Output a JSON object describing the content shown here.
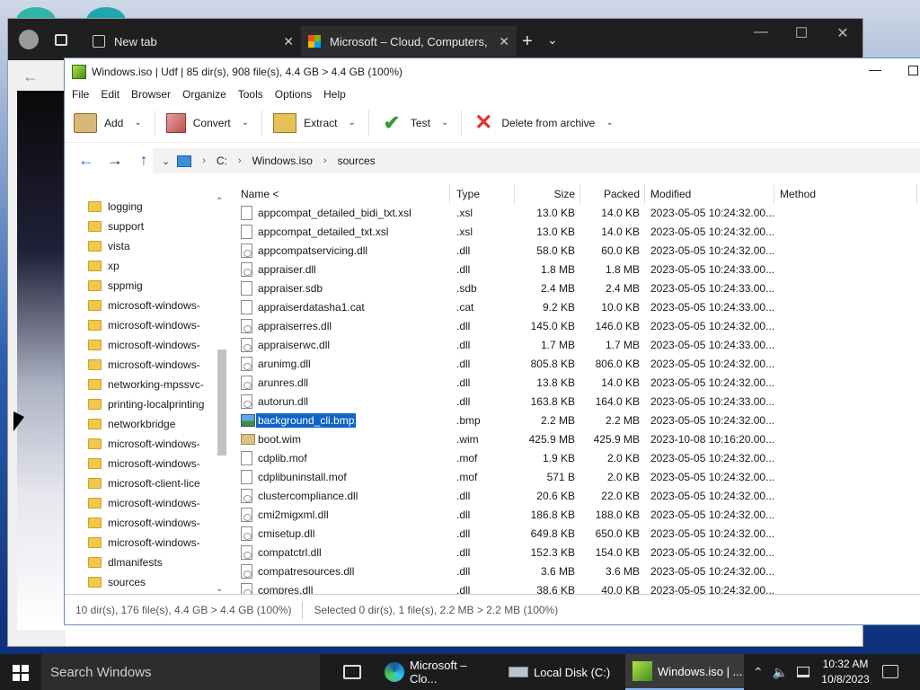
{
  "browser": {
    "tab1": "New tab",
    "tab2": "Microsoft – Cloud, Computers, A",
    "new_tab": "+",
    "tabs_menu": "⌄"
  },
  "zip": {
    "title": "Windows.iso | Udf | 85 dir(s), 908 file(s), 4.4 GB > 4.4 GB (100%)",
    "menu": [
      "File",
      "Edit",
      "Browser",
      "Organize",
      "Tools",
      "Options",
      "Help"
    ],
    "toolbar": {
      "add": "Add",
      "convert": "Convert",
      "extract": "Extract",
      "test": "Test",
      "delete": "Delete from archive"
    },
    "breadcrumb": [
      "C:",
      "Windows.iso",
      "sources"
    ],
    "tree": [
      "logging",
      "support",
      "vista",
      "xp",
      "sppmig",
      "microsoft-windows-",
      "microsoft-windows-",
      "microsoft-windows-",
      "microsoft-windows-",
      "networking-mpssvc-",
      "printing-localprinting",
      "networkbridge",
      "microsoft-windows-",
      "microsoft-windows-",
      "microsoft-client-lice",
      "microsoft-windows-",
      "microsoft-windows-",
      "microsoft-windows-",
      "dlmanifests",
      "sources"
    ],
    "columns": {
      "name": "Name <",
      "type": "Type",
      "size": "Size",
      "packed": "Packed",
      "modified": "Modified",
      "method": "Method"
    },
    "files": [
      {
        "name": "appcompat_detailed_bidi_txt.xsl",
        "type": ".xsl",
        "size": "13.0 KB",
        "packed": "14.0 KB",
        "modified": "2023-05-05 10:24:32.00...",
        "icon": "doc"
      },
      {
        "name": "appcompat_detailed_txt.xsl",
        "type": ".xsl",
        "size": "13.0 KB",
        "packed": "14.0 KB",
        "modified": "2023-05-05 10:24:32.00...",
        "icon": "doc"
      },
      {
        "name": "appcompatservicing.dll",
        "type": ".dll",
        "size": "58.0 KB",
        "packed": "60.0 KB",
        "modified": "2023-05-05 10:24:32.00...",
        "icon": "dll"
      },
      {
        "name": "appraiser.dll",
        "type": ".dll",
        "size": "1.8 MB",
        "packed": "1.8 MB",
        "modified": "2023-05-05 10:24:33.00...",
        "icon": "dll"
      },
      {
        "name": "appraiser.sdb",
        "type": ".sdb",
        "size": "2.4 MB",
        "packed": "2.4 MB",
        "modified": "2023-05-05 10:24:33.00...",
        "icon": "doc"
      },
      {
        "name": "appraiserdatasha1.cat",
        "type": ".cat",
        "size": "9.2 KB",
        "packed": "10.0 KB",
        "modified": "2023-05-05 10:24:33.00...",
        "icon": "doc"
      },
      {
        "name": "appraiserres.dll",
        "type": ".dll",
        "size": "145.0 KB",
        "packed": "146.0 KB",
        "modified": "2023-05-05 10:24:32.00...",
        "icon": "dll"
      },
      {
        "name": "appraiserwc.dll",
        "type": ".dll",
        "size": "1.7 MB",
        "packed": "1.7 MB",
        "modified": "2023-05-05 10:24:33.00...",
        "icon": "dll"
      },
      {
        "name": "arunimg.dll",
        "type": ".dll",
        "size": "805.8 KB",
        "packed": "806.0 KB",
        "modified": "2023-05-05 10:24:32.00...",
        "icon": "dll"
      },
      {
        "name": "arunres.dll",
        "type": ".dll",
        "size": "13.8 KB",
        "packed": "14.0 KB",
        "modified": "2023-05-05 10:24:32.00...",
        "icon": "dll"
      },
      {
        "name": "autorun.dll",
        "type": ".dll",
        "size": "163.8 KB",
        "packed": "164.0 KB",
        "modified": "2023-05-05 10:24:33.00...",
        "icon": "dll"
      },
      {
        "name": "background_cli.bmp",
        "type": ".bmp",
        "size": "2.2 MB",
        "packed": "2.2 MB",
        "modified": "2023-05-05 10:24:32.00...",
        "icon": "bmp",
        "selected": true
      },
      {
        "name": "boot.wim",
        "type": ".wim",
        "size": "425.9 MB",
        "packed": "425.9 MB",
        "modified": "2023-10-08 10:16:20.00...",
        "icon": "folder"
      },
      {
        "name": "cdplib.mof",
        "type": ".mof",
        "size": "1.9 KB",
        "packed": "2.0 KB",
        "modified": "2023-05-05 10:24:32.00...",
        "icon": "doc"
      },
      {
        "name": "cdplibuninstall.mof",
        "type": ".mof",
        "size": "571 B",
        "packed": "2.0 KB",
        "modified": "2023-05-05 10:24:32.00...",
        "icon": "doc"
      },
      {
        "name": "clustercompliance.dll",
        "type": ".dll",
        "size": "20.6 KB",
        "packed": "22.0 KB",
        "modified": "2023-05-05 10:24:32.00...",
        "icon": "dll"
      },
      {
        "name": "cmi2migxml.dll",
        "type": ".dll",
        "size": "186.8 KB",
        "packed": "188.0 KB",
        "modified": "2023-05-05 10:24:32.00...",
        "icon": "dll"
      },
      {
        "name": "cmisetup.dll",
        "type": ".dll",
        "size": "649.8 KB",
        "packed": "650.0 KB",
        "modified": "2023-05-05 10:24:32.00...",
        "icon": "dll"
      },
      {
        "name": "compatctrl.dll",
        "type": ".dll",
        "size": "152.3 KB",
        "packed": "154.0 KB",
        "modified": "2023-05-05 10:24:32.00...",
        "icon": "dll"
      },
      {
        "name": "compatresources.dll",
        "type": ".dll",
        "size": "3.6 MB",
        "packed": "3.6 MB",
        "modified": "2023-05-05 10:24:32.00...",
        "icon": "dll"
      },
      {
        "name": "compres.dll",
        "type": ".dll",
        "size": "38.6 KB",
        "packed": "40.0 KB",
        "modified": "2023-05-05 10:24:32.00...",
        "icon": "dll"
      }
    ],
    "status_left": "10 dir(s), 176 file(s), 4.4 GB > 4.4 GB (100%)",
    "status_right": "Selected 0 dir(s), 1 file(s), 2.2 MB > 2.2 MB (100%)"
  },
  "taskbar": {
    "search_placeholder": "Search Windows",
    "task_edge": "Microsoft – Clo...",
    "task_explorer": "Local Disk (C:)",
    "task_zip": "Windows.iso | ...",
    "time": "10:32 AM",
    "date": "10/8/2023"
  },
  "colors": {
    "selection": "#0e63c8",
    "accent": "#1a6ed8"
  }
}
